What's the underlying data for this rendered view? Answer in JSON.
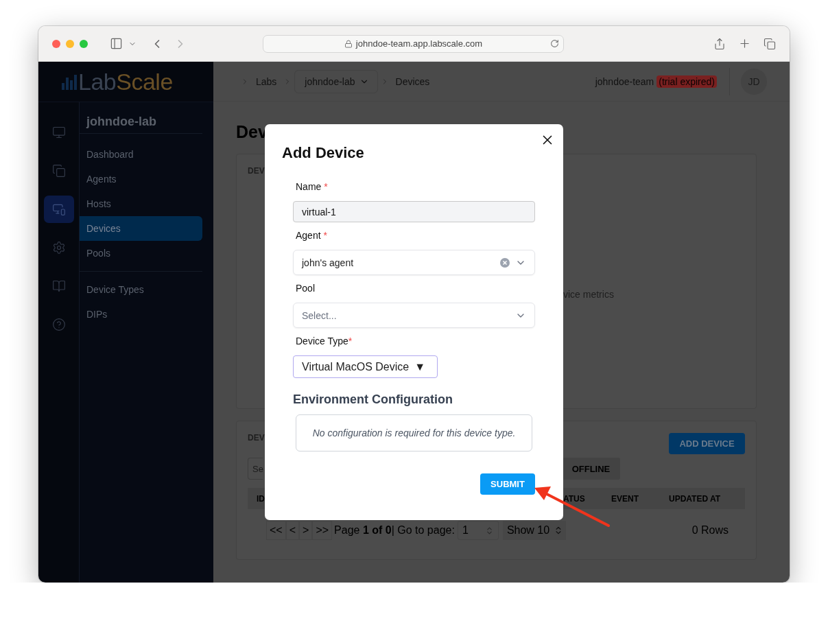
{
  "browser": {
    "url": "johndoe-team.app.labscale.com"
  },
  "logo": {
    "first": "Lab",
    "second": "Scale"
  },
  "rail": [
    {
      "selected": false
    },
    {
      "selected": false
    },
    {
      "selected": true
    },
    {
      "selected": false
    },
    {
      "selected": false
    },
    {
      "selected": false
    }
  ],
  "nav": {
    "title": "johndoe-lab",
    "groups": [
      {
        "items": [
          {
            "label": "Dashboard",
            "selected": false
          },
          {
            "label": "Agents",
            "selected": false
          },
          {
            "label": "Hosts",
            "selected": false
          },
          {
            "label": "Devices",
            "selected": true
          },
          {
            "label": "Pools",
            "selected": false
          }
        ]
      },
      {
        "items": [
          {
            "label": "Device Types",
            "selected": false
          },
          {
            "label": "DIPs",
            "selected": false
          }
        ]
      }
    ]
  },
  "header": {
    "breadcrumbs": [
      {
        "label": "Labs",
        "kind": "link"
      },
      {
        "label": "johndoe-lab",
        "kind": "dropdown"
      },
      {
        "label": "Devices",
        "kind": "link"
      }
    ],
    "team": "johndoe-team",
    "badge": "(trial expired)",
    "avatar": "JD"
  },
  "page": {
    "title": "Dev",
    "metrics_card": {
      "heading": "DEV",
      "message": "vice metrics"
    },
    "devices_card": {
      "heading": "DEV",
      "add_button": "ADD DEVICE",
      "search": {
        "placeholder": "Se"
      },
      "filters": [
        "OFFLINE"
      ],
      "columns": [
        "ID",
        "ATUS",
        "EVENT",
        "UPDATED AT"
      ],
      "pagination": {
        "buttons": [
          "<<",
          "<",
          ">",
          ">>"
        ],
        "page_text": "Page **1 of 0**| Go to page:",
        "page_input": "1",
        "show": "Show 10",
        "rows": "0 Rows"
      }
    }
  },
  "dialog": {
    "title": "Add Device",
    "fields": [
      {
        "kind": "text",
        "label": "Name",
        "mark": "*",
        "value": "virtual-1"
      },
      {
        "kind": "select",
        "label": "Agent",
        "mark": "*",
        "value": "john's agent",
        "clearable": true
      },
      {
        "kind": "select",
        "label": "Pool",
        "placeholder": "Select...",
        "clearable": false
      },
      {
        "kind": "native",
        "label": "Device Type",
        "mark": "*",
        "value": "Virtual MacOS Device",
        "arrow": "▼"
      }
    ],
    "section": "Environment Configuration",
    "note": "No configuration is required for this device type.",
    "submit": "SUBMIT"
  }
}
